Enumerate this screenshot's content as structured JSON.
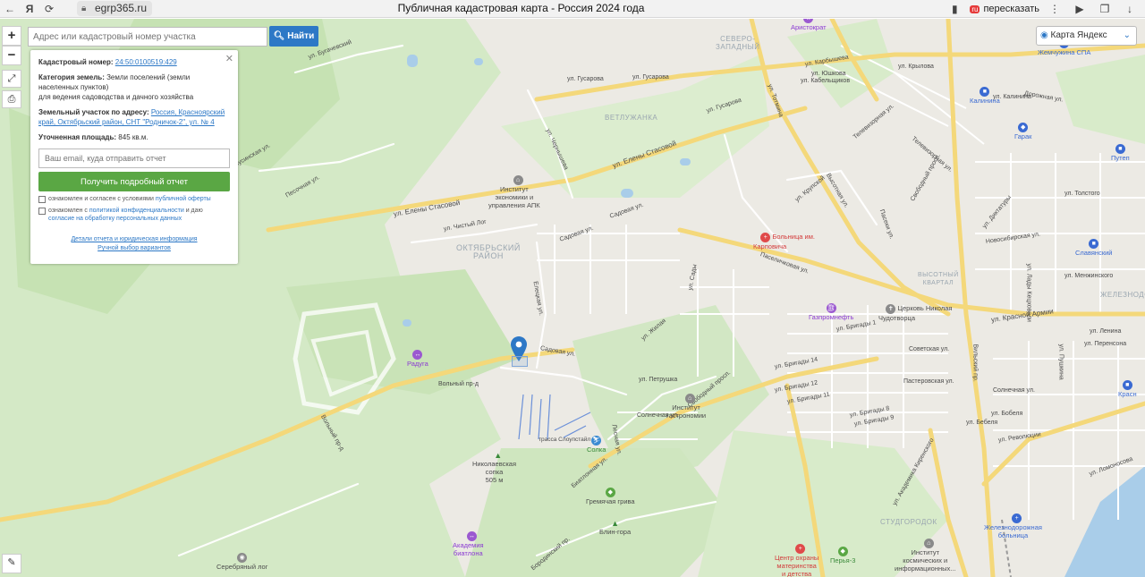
{
  "browser": {
    "url": "egrp365.ru",
    "title": "Публичная кадастровая карта - Россия 2024 года",
    "translate_label": "пересказать",
    "translate_badge": "ru"
  },
  "search": {
    "placeholder": "Адрес или кадастровый номер участка",
    "button_label": "Найти"
  },
  "zoom": {
    "in": "+",
    "out": "−"
  },
  "map_type": {
    "label": "Карта Яндекс"
  },
  "info_panel": {
    "cadastral_label": "Кадастровый номер:",
    "cadastral_value": "24:50:0100519:429",
    "category_label": "Категория земель:",
    "category_value": "Земли поселений (земли населенных пунктов)",
    "usage_value": "для ведения садоводства и дачного хозяйства",
    "address_label": "Земельный участок по адресу:",
    "address_value": "Россия, Красноярский край, Октябрьский район, СНТ \"Родничок-2\", ул. № 4",
    "area_label": "Уточненная площадь:",
    "area_value": "845 кв.м.",
    "email_placeholder": "Ваш email, куда отправить отчет",
    "get_report_button": "Получить подробный отчет",
    "agree1_text": "ознакомлен и согласен с условиями",
    "agree1_link": "публичной оферты",
    "agree2_text": "ознакомлен с",
    "agree2_link1": "политикой конфиденциальности",
    "agree2_mid": "и даю",
    "agree2_link2": "согласие на обработку персональных данных",
    "details_link": "Детали отчета и юридическая информация",
    "manual_link": "Ручной выбор вариантов"
  },
  "map_labels": {
    "streets": [
      "ул. Бугачевский",
      "Минусинская ул.",
      "Песочная ул.",
      "ул. Гусарова",
      "ул. Гусарова",
      "ул. Гусарова",
      "ул. Чернышева",
      "ул. Елены Стасовой",
      "ул. Елены Стасовой",
      "ул. Чистый Лог",
      "Садовая ул.",
      "Садовая ул.",
      "Елецкая ул.",
      "Вольный пр-д",
      "Вольный пр-д",
      "Садовая ул.",
      "ул. Петрушка",
      "Солнечная ул.",
      "Лесная ул.",
      "Биатлонная ул.",
      "ул. Жилая",
      "ул. Сады",
      "Свободный просп.",
      "ул. Калинина",
      "Высотная ул.",
      "Пасеки ул.",
      "Телевизорная ул.",
      "Телевизорная ул.",
      "Паселичковая ул.",
      "Свободный просп.",
      "ул. Бригады 1",
      "Советская ул.",
      "ул. Красной Армии",
      "Новосибирская ул.",
      "ул. Менжинского",
      "ул. Толстого",
      "Вильский пр.",
      "Бородинский пр.",
      "ул. Бригады 8",
      "ул. Бригады 9",
      "ул. Бригады 11",
      "ул. Бригады 12",
      "ул. Бригады 14",
      "Пастеровская ул.",
      "Солнечная ул.",
      "ул. Бобеля",
      "ул. Революции",
      "ул. Ломоносова",
      "ул. Академика Киренского",
      "ул. Кабельщиков",
      "Дорожная ул.",
      "ул. Юшкова",
      "ул. Крылова",
      "ул. Ленина",
      "ул. Перенсона",
      "ул. Пушкина",
      "ул. Лады Кецховели",
      "ул. Диктатуры",
      "ул. Карбышева",
      "ул. Крупской",
      "ул. Тотмина",
      "ул. Бебеля"
    ],
    "districts": [
      "ОКТЯБРЬСКИЙ\nРАЙОН",
      "ВЕТЛУЖАНКА",
      "СЕВЕРО-\nЗАПАДНЫЙ",
      "ВЫСОТНЫЙ\nКВАРТАЛ",
      "ЖЕЛЕЗНОДО",
      "СТУДГОРОДОК"
    ],
    "pois": [
      "Институт\nэкономики и\nуправления АПК",
      "Больница им.\nКарповича",
      "Газпромнефть",
      "Церковь Николая\nЧудотворца",
      "Радуга",
      "Институт\nгастрономии",
      "Солка",
      "Николаевская\nсопка\n505 м",
      "Гремячая грива",
      "Блин-гора",
      "Академия\nбиатлона",
      "Серебряный лог",
      "Центр охраны\nматеринства\nи детства",
      "Перья-3",
      "Институт\nкосмических и\nинформационных...",
      "Железнодорожная\nбольница",
      "Аристократ",
      "Жемчужина СПА",
      "Калинина",
      "Гарак",
      "Славянский",
      "Путеп",
      "Красн",
      "трасса Слоупстайл"
    ]
  },
  "colors": {
    "forest": "#cfe6bf",
    "forest_dark": "#bcdca8",
    "water": "#a9cde9",
    "road_major": "#f7df7a",
    "road_minor": "#ffffff",
    "urban": "#ebe9e4",
    "accent_blue": "#2d78c6",
    "button_green": "#5aa744"
  },
  "icons": {
    "back": "arrow-left-icon",
    "yandex": "yandex-icon",
    "reload": "reload-icon",
    "lock": "lock-icon",
    "bookmark": "bookmark-icon",
    "menu": "more-vert-icon",
    "fullscreen": "fullscreen-icon",
    "print": "print-icon",
    "ruler": "ruler-icon",
    "pin": "location-pin-icon"
  }
}
